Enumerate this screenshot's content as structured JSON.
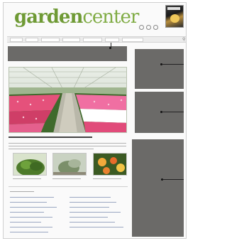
{
  "site": {
    "logo_bold": "garden",
    "logo_light": "center"
  },
  "colors": {
    "brand_green": "#6f9a35",
    "ad_placeholder": "#6b6a68",
    "navbar_bg": "#ececec"
  },
  "icons": [
    "facebook-icon",
    "twitter-icon",
    "rss-icon",
    "search-icon"
  ]
}
